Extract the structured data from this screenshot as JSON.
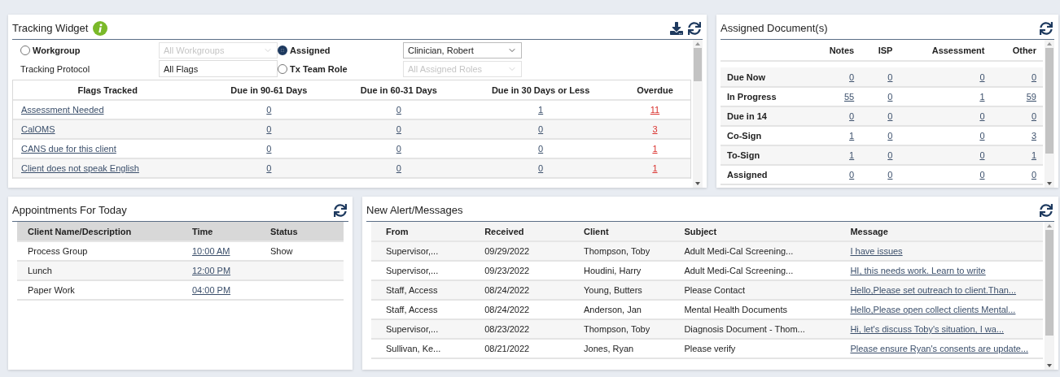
{
  "tracking_widget": {
    "title": "Tracking Widget",
    "filters": {
      "workgroup_radio": {
        "label": "Workgroup",
        "selected": false
      },
      "workgroup_select": {
        "value": "All Workgroups",
        "disabled": true
      },
      "assigned_radio": {
        "label": "Assigned",
        "selected": true
      },
      "assigned_select": {
        "value": "Clinician, Robert",
        "disabled": false
      },
      "protocol_label": "Tracking Protocol",
      "protocol_field": {
        "value": "All Flags"
      },
      "team_role_radio": {
        "label": "Tx Team Role",
        "selected": false
      },
      "team_role_select": {
        "value": "All Assigned Roles",
        "disabled": true
      }
    },
    "columns": [
      "Flags Tracked",
      "Due in 90-61 Days",
      "Due in 60-31 Days",
      "Due in 30 Days or Less",
      "Overdue"
    ],
    "rows": [
      {
        "flag": "Assessment Needed",
        "counts": [
          {
            "value": "0",
            "alert": false
          },
          {
            "value": "0",
            "alert": false
          },
          {
            "value": "1",
            "alert": false
          },
          {
            "value": "11",
            "alert": true
          }
        ]
      },
      {
        "flag": "CalOMS",
        "counts": [
          {
            "value": "0",
            "alert": false
          },
          {
            "value": "0",
            "alert": false
          },
          {
            "value": "0",
            "alert": false
          },
          {
            "value": "3",
            "alert": true
          }
        ]
      },
      {
        "flag": "CANS due for this client",
        "counts": [
          {
            "value": "0",
            "alert": false
          },
          {
            "value": "0",
            "alert": false
          },
          {
            "value": "0",
            "alert": false
          },
          {
            "value": "1",
            "alert": true
          }
        ]
      },
      {
        "flag": "Client does not speak English",
        "counts": [
          {
            "value": "0",
            "alert": false
          },
          {
            "value": "0",
            "alert": false
          },
          {
            "value": "0",
            "alert": false
          },
          {
            "value": "1",
            "alert": true
          }
        ]
      }
    ]
  },
  "assigned_documents": {
    "title": "Assigned Document(s)",
    "columns": [
      "Notes",
      "ISP",
      "Assessment",
      "Other"
    ],
    "rows": [
      {
        "label": "Due Now",
        "counts": [
          "0",
          "0",
          "0",
          "0"
        ]
      },
      {
        "label": "In Progress",
        "counts": [
          "55",
          "0",
          "1",
          "59"
        ]
      },
      {
        "label": "Due in 14",
        "counts": [
          "0",
          "0",
          "0",
          "0"
        ]
      },
      {
        "label": "Co-Sign",
        "counts": [
          "1",
          "0",
          "0",
          "3"
        ]
      },
      {
        "label": "To-Sign",
        "counts": [
          "1",
          "0",
          "0",
          "1"
        ]
      },
      {
        "label": "Assigned",
        "counts": [
          "0",
          "0",
          "0",
          "0"
        ]
      }
    ]
  },
  "appointments": {
    "title": "Appointments For Today",
    "columns": [
      "Client Name/Description",
      "Time",
      "Status"
    ],
    "rows": [
      {
        "description": "Process Group",
        "time": "10:00 AM",
        "status": "Show"
      },
      {
        "description": "Lunch",
        "time": "12:00 PM"
      },
      {
        "description": "Paper Work",
        "time": "04:00 PM"
      }
    ]
  },
  "messages": {
    "title": "New Alert/Messages",
    "columns": [
      "From",
      "Received",
      "Client",
      "Subject",
      "Message"
    ],
    "rows": [
      {
        "from": "Supervisor,...",
        "received": "09/29/2022",
        "client": "Thompson, Toby",
        "subject": "Adult Medi-Cal Screening...",
        "message": "I have issues"
      },
      {
        "from": "Supervisor,...",
        "received": "09/23/2022",
        "client": "Houdini, Harry",
        "subject": "Adult Medi-Cal Screening...",
        "message": "HI, this needs work. Learn to write"
      },
      {
        "from": "Staff, Access",
        "received": "08/24/2022",
        "client": "Young, Butters",
        "subject": "Please Contact",
        "message": "Hello,Please set outreach to client.Than..."
      },
      {
        "from": "Staff, Access",
        "received": "08/24/2022",
        "client": "Anderson, Jan",
        "subject": "Mental Health Documents",
        "message": "Hello,Please open collect clients Mental..."
      },
      {
        "from": "Supervisor,...",
        "received": "08/23/2022",
        "client": "Thompson, Toby",
        "subject": "Diagnosis Document - Thom...",
        "message": "Hi, let's discuss Toby's situation, I wa..."
      },
      {
        "from": "Sullivan, Ke...",
        "received": "08/21/2022",
        "client": "Jones, Ryan",
        "subject": "Please verify",
        "message": "Please ensure Ryan's consents are update..."
      }
    ]
  }
}
